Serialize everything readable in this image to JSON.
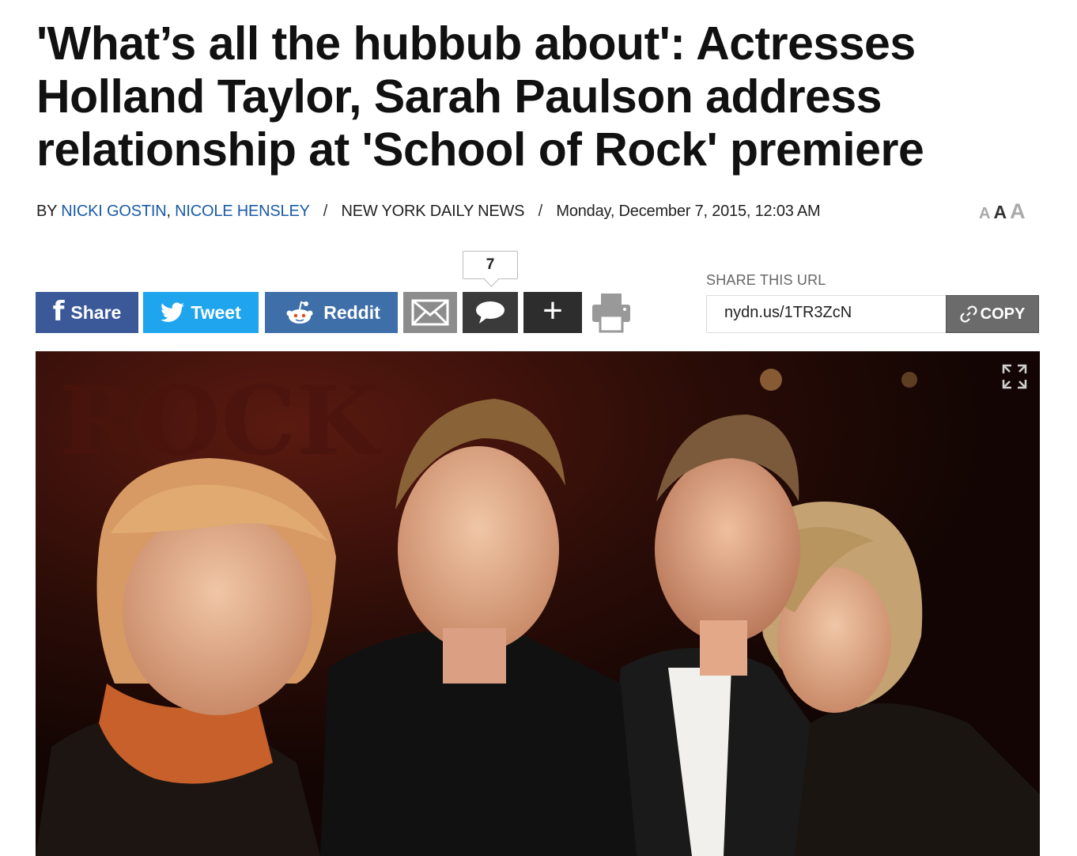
{
  "article": {
    "headline": "'What’s all the hubbub about': Actresses Holland Taylor, Sarah Paulson address relationship at 'School of Rock' premiere",
    "byline": {
      "by": "BY",
      "authors": [
        "NICKI GOSTIN",
        "NICOLE HENSLEY"
      ],
      "author_separator": ",",
      "separator": "/",
      "publication": "NEW YORK DAILY NEWS",
      "date": "Monday, December 7, 2015, 12:03 AM"
    },
    "font_size_controls": [
      "A",
      "A",
      "A"
    ]
  },
  "share_bar": {
    "facebook": {
      "label": "Share",
      "icon": "facebook-icon",
      "color": "#3b5998"
    },
    "twitter": {
      "label": "Tweet",
      "icon": "twitter-bird-icon",
      "color": "#1fa5ee"
    },
    "reddit": {
      "label": "Reddit",
      "icon": "reddit-alien-icon",
      "color": "#3e6fa8"
    },
    "email": {
      "icon": "envelope-icon"
    },
    "comments": {
      "count": "7",
      "icon": "speech-bubble-icon"
    },
    "more": {
      "icon": "plus-icon"
    },
    "print": {
      "icon": "printer-icon"
    }
  },
  "share_url": {
    "label": "SHARE THIS URL",
    "value": "nydn.us/1TR3ZcN",
    "copy_label": "COPY",
    "copy_icon": "link-icon"
  },
  "photo": {
    "expand_icon": "expand-arrows-icon"
  }
}
